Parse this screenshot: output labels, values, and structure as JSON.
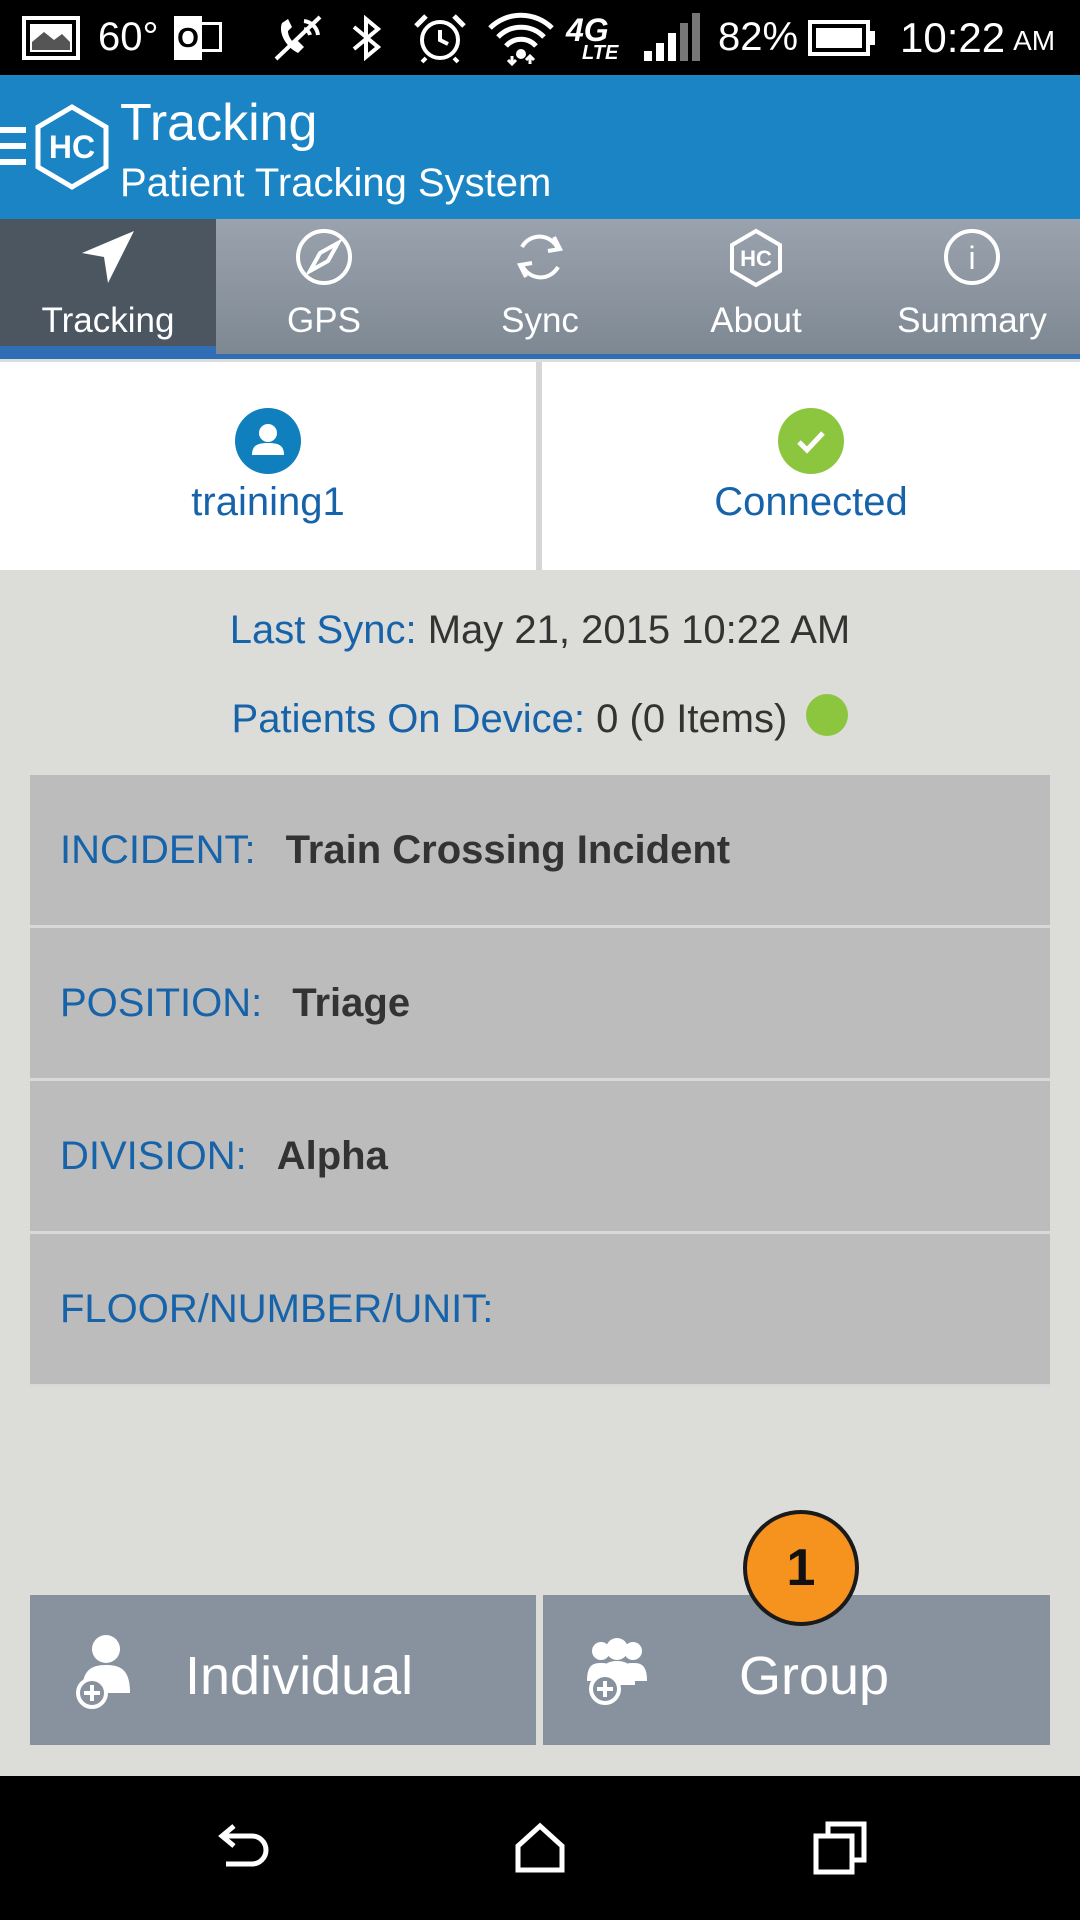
{
  "status_bar": {
    "temperature": "60°",
    "outlook_letter": "O",
    "network_type": "4G",
    "network_sub": "LTE",
    "battery": "82%",
    "time": "10:22",
    "ampm": "AM"
  },
  "header": {
    "logo_text": "HC",
    "title": "Tracking",
    "subtitle": "Patient Tracking System"
  },
  "tabs": [
    {
      "label": "Tracking",
      "icon": "navigation-arrow-icon",
      "active": true
    },
    {
      "label": "GPS",
      "icon": "compass-icon"
    },
    {
      "label": "Sync",
      "icon": "sync-icon"
    },
    {
      "label": "About",
      "icon": "hc-logo-icon",
      "icon_text": "HC"
    },
    {
      "label": "Summary",
      "icon": "info-icon",
      "icon_text": "i"
    }
  ],
  "user_panel": {
    "username": "training1"
  },
  "connection_panel": {
    "status": "Connected"
  },
  "sync": {
    "label": "Last Sync:",
    "value": "May 21, 2015 10:22 AM"
  },
  "device": {
    "label": "Patients On Device:",
    "value": "0 (0 Items)"
  },
  "details": [
    {
      "label": "INCIDENT:",
      "value": "Train Crossing Incident"
    },
    {
      "label": "POSITION:",
      "value": "Triage"
    },
    {
      "label": "DIVISION:",
      "value": "Alpha"
    },
    {
      "label": "FLOOR/NUMBER/UNIT:",
      "value": ""
    }
  ],
  "buttons": {
    "individual": "Individual",
    "group": "Group"
  },
  "badge": {
    "number": "1"
  },
  "colors": {
    "brand_blue": "#1a84c4",
    "label_blue": "#1763aa",
    "status_green": "#8cc63f",
    "badge_orange": "#f6921e",
    "button_gray": "#87929e"
  }
}
